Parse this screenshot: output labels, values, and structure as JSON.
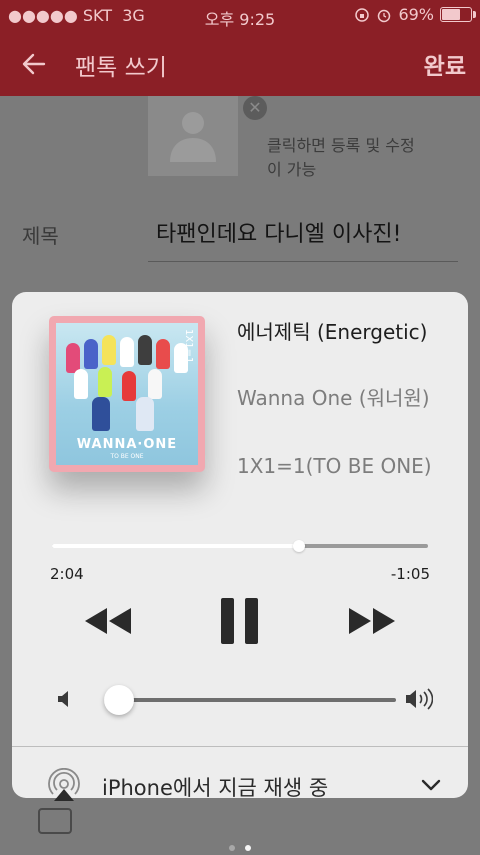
{
  "status_bar": {
    "carrier": "●●●●● SKT",
    "network": "3G",
    "time": "오후 9:25",
    "battery_text": "69%",
    "battery_level": 0.69
  },
  "app_bar": {
    "title": "팬톡 쓰기",
    "done_label": "완료"
  },
  "form": {
    "photo_remove": "✕",
    "photo_hint": "클릭하면 등록 및 수정이 가능",
    "subject_label": "제목",
    "subject_value": "타팬인데요 다니엘 이사진!"
  },
  "now_playing": {
    "album_art": {
      "logo_text": "WANNA·ONE",
      "subtitle": "TO BE ONE",
      "side_text": "1X1=1"
    },
    "title": "에너제틱 (Energetic)",
    "artist": "Wanna One (워너원)",
    "album": "1X1=1(TO BE ONE)",
    "elapsed": "2:04",
    "remaining": "-1:05",
    "progress_fraction": 0.656,
    "volume_fraction": 0.05,
    "output_device_label": "iPhone에서 지금 재생 중"
  },
  "icons": {
    "back": "left-arrow",
    "rewind": "rewind-icon",
    "pause": "pause-icon",
    "fast_forward": "fast-forward-icon",
    "airplay": "airplay-icon",
    "chevron": "chevron-down-icon",
    "volume_min": "speaker-icon",
    "volume_max": "speaker-loud-icon"
  },
  "page_indicator": {
    "count": 2,
    "active_index": 1
  },
  "colors": {
    "header": "#8b1f26",
    "header_text": "#f2c9cc",
    "card_bg": "#ededed",
    "album_frame": "#f1a8b0"
  }
}
